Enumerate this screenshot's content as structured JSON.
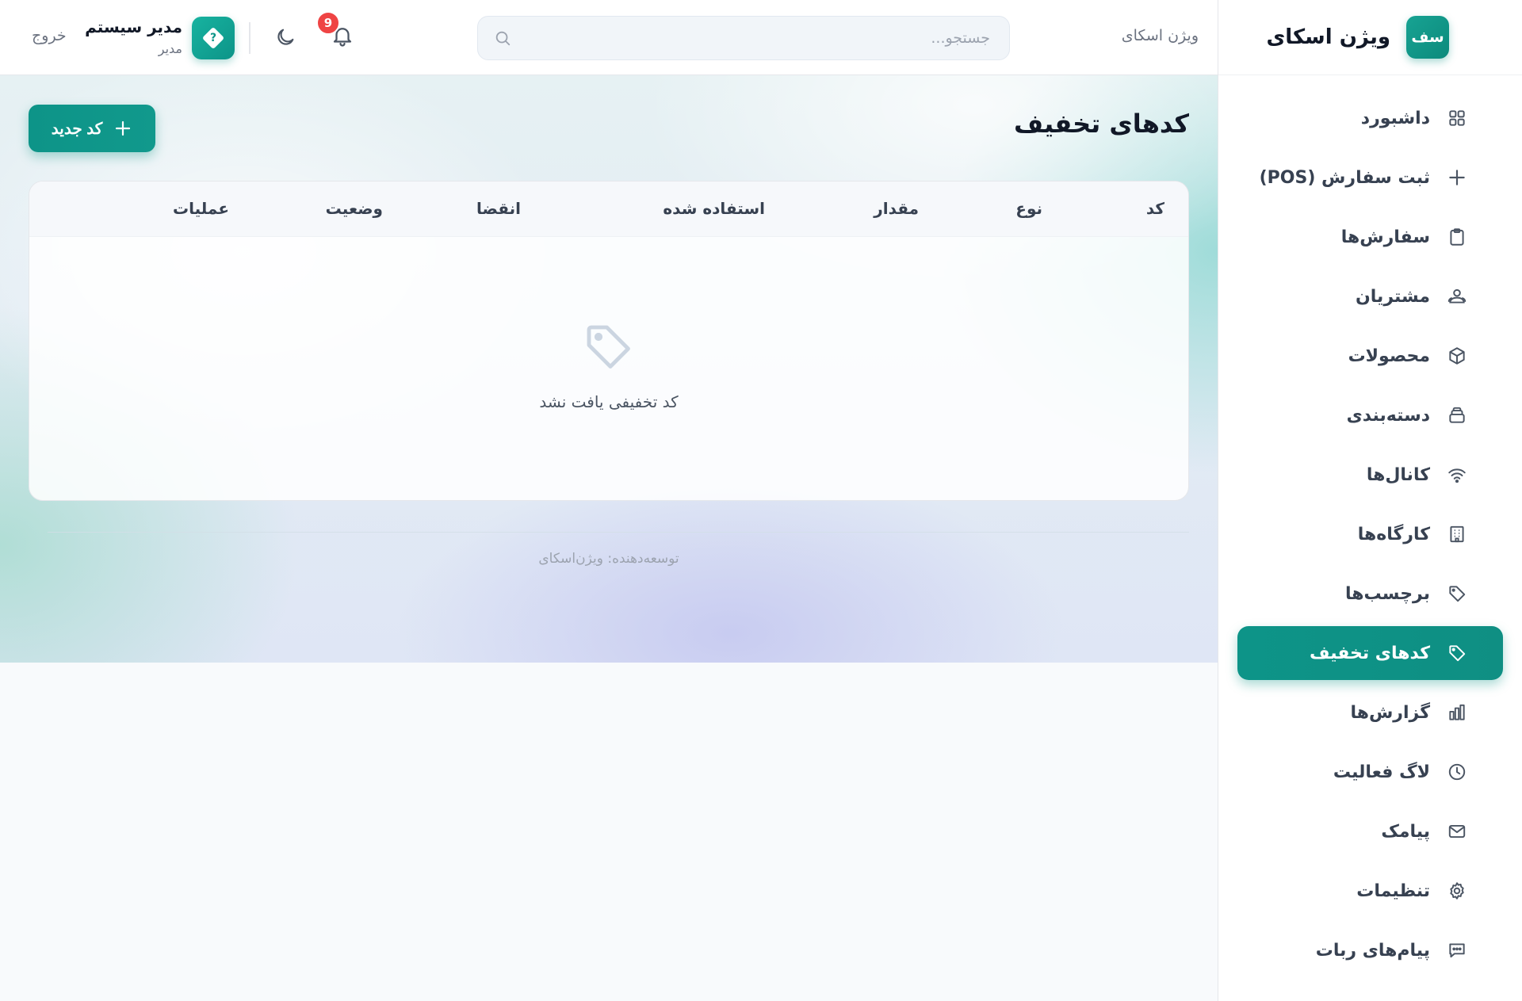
{
  "brand": {
    "logo_text": "سف",
    "name": "ویژن اسکای"
  },
  "sidebar": {
    "items": [
      {
        "label": "داشبورد",
        "icon": "dashboard-grid-icon",
        "active": false
      },
      {
        "label": "ثبت سفارش (POS)",
        "icon": "plus-icon",
        "active": false
      },
      {
        "label": "سفارش‌ها",
        "icon": "clipboard-icon",
        "active": false
      },
      {
        "label": "مشتریان",
        "icon": "users-icon",
        "active": false
      },
      {
        "label": "محصولات",
        "icon": "cube-icon",
        "active": false
      },
      {
        "label": "دسته‌بندی",
        "icon": "layers-icon",
        "active": false
      },
      {
        "label": "کانال‌ها",
        "icon": "wifi-icon",
        "active": false
      },
      {
        "label": "کارگاه‌ها",
        "icon": "building-icon",
        "active": false
      },
      {
        "label": "برچسب‌ها",
        "icon": "tag-icon",
        "active": false
      },
      {
        "label": "کدهای تخفیف",
        "icon": "tag-icon",
        "active": true
      },
      {
        "label": "گزارش‌ها",
        "icon": "bar-chart-icon",
        "active": false
      },
      {
        "label": "لاگ فعالیت",
        "icon": "clock-icon",
        "active": false
      },
      {
        "label": "پیامک",
        "icon": "mail-icon",
        "active": false
      },
      {
        "label": "تنظیمات",
        "icon": "gear-icon",
        "active": false
      },
      {
        "label": "پیام‌های ربات",
        "icon": "chat-icon",
        "active": false
      }
    ]
  },
  "header": {
    "site_name": "ویژن اسکای",
    "search_placeholder": "جستجو...",
    "notification_count": "9",
    "user_name": "مدیر سیستم",
    "user_role": "مدیر",
    "logout_label": "خروج"
  },
  "page": {
    "title": "کدهای تخفیف",
    "new_button_label": "کد جدید"
  },
  "table": {
    "columns": [
      "کد",
      "نوع",
      "مقدار",
      "استفاده شده",
      "انقضا",
      "وضعیت",
      "عملیات"
    ],
    "empty_message": "کد تخفیفی یافت نشد"
  },
  "footer": {
    "text": "توسعه‌دهنده: ویژن‌اسکای"
  },
  "colors": {
    "accent": "#0d9488",
    "badge": "#ef4444"
  }
}
